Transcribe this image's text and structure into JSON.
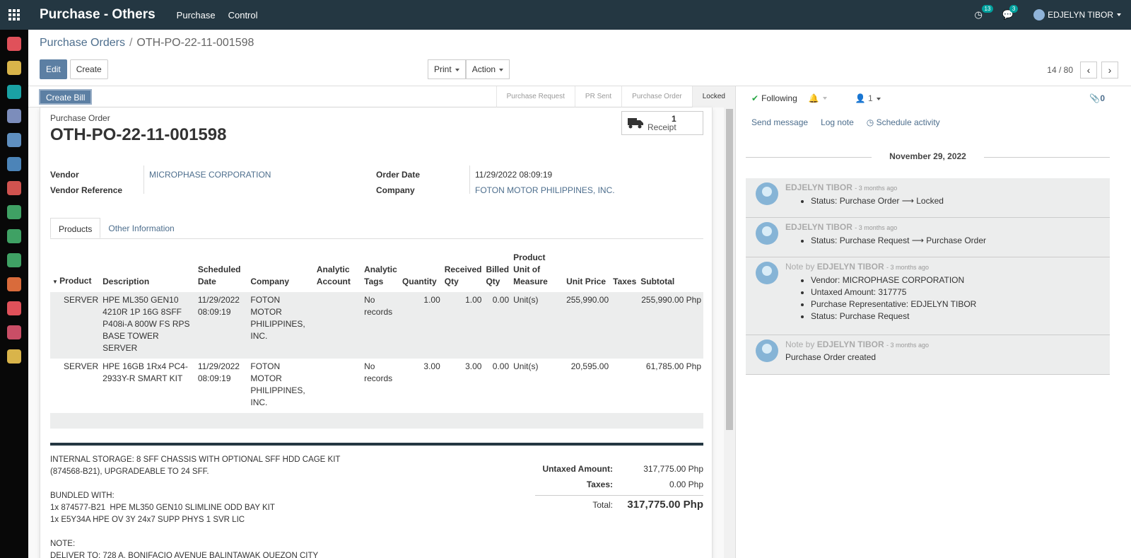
{
  "app": {
    "title": "Purchase - Others",
    "menu": [
      "Purchase",
      "Control"
    ],
    "activity_count": "13",
    "message_count": "3",
    "user": "EDJELYN TIBOR"
  },
  "breadcrumb": {
    "parent": "Purchase Orders",
    "current": "OTH-PO-22-11-001598"
  },
  "controls": {
    "edit": "Edit",
    "create": "Create",
    "print": "Print",
    "action": "Action",
    "pager": "14 / 80"
  },
  "status": {
    "create_bill": "Create Bill",
    "stages": [
      "Purchase Request",
      "PR Sent",
      "Purchase Order",
      "Locked"
    ],
    "active_stage": "Locked"
  },
  "form": {
    "label": "Purchase Order",
    "name": "OTH-PO-22-11-001598",
    "receipt_count": "1",
    "receipt_label": "Receipt",
    "vendor_label": "Vendor",
    "vendor": "MICROPHASE CORPORATION",
    "vendor_ref_label": "Vendor Reference",
    "order_date_label": "Order Date",
    "order_date": "11/29/2022 08:09:19",
    "company_label": "Company",
    "company": "FOTON MOTOR PHILIPPINES, INC.",
    "tabs": [
      "Products",
      "Other Information"
    ]
  },
  "lines": {
    "headers": [
      "Product",
      "Description",
      "Scheduled Date",
      "Company",
      "Analytic Account",
      "Analytic Tags",
      "Quantity",
      "Received Qty",
      "Billed Qty",
      "Product Unit of Measure",
      "Unit Price",
      "Taxes",
      "Subtotal"
    ],
    "rows": [
      {
        "product": "SERVER",
        "description": "HPE ML350 GEN10 4210R 1P 16G 8SFF P408i-A 800W FS RPS BASE TOWER SERVER",
        "date": "11/29/2022 08:09:19",
        "company": "FOTON MOTOR PHILIPPINES, INC.",
        "account": "",
        "tags": "No records",
        "qty": "1.00",
        "received": "1.00",
        "billed": "0.00",
        "uom": "Unit(s)",
        "price": "255,990.00",
        "taxes": "",
        "subtotal": "255,990.00 Php"
      },
      {
        "product": "SERVER",
        "description": "HPE 16GB 1Rx4 PC4-2933Y-R SMART KIT",
        "date": "11/29/2022 08:09:19",
        "company": "FOTON MOTOR PHILIPPINES, INC.",
        "account": "",
        "tags": "No records",
        "qty": "3.00",
        "received": "3.00",
        "billed": "0.00",
        "uom": "Unit(s)",
        "price": "20,595.00",
        "taxes": "",
        "subtotal": "61,785.00 Php"
      }
    ]
  },
  "notes": "INTERNAL STORAGE: 8 SFF CHASSIS WITH OPTIONAL SFF HDD CAGE KIT\n(874568-B21), UPGRADEABLE TO 24 SFF.\n\nBUNDLED WITH:\n1x 874577-B21  HPE ML350 GEN10 SLIMLINE ODD BAY KIT\n1x E5Y34A HPE OV 3Y 24x7 SUPP PHYS 1 SVR LIC\n\nNOTE:\nDELIVER TO: 728 A. BONIFACIO AVENUE BALINTAWAK QUEZON CITY",
  "totals": {
    "untaxed_label": "Untaxed Amount:",
    "untaxed": "317,775.00 Php",
    "taxes_label": "Taxes:",
    "taxes": "0.00 Php",
    "total_label": "Total:",
    "total": "317,775.00 Php"
  },
  "chatter": {
    "following": "Following",
    "followers": "1",
    "attachments": "0",
    "send_message": "Send message",
    "log_note": "Log note",
    "schedule": "Schedule activity",
    "date": "November 29, 2022",
    "messages": [
      {
        "prefix": "",
        "author": "EDJELYN TIBOR",
        "ago": "- 3 months ago",
        "items": [
          "Status: Purchase Order ⟶ Locked"
        ]
      },
      {
        "prefix": "",
        "author": "EDJELYN TIBOR",
        "ago": "- 3 months ago",
        "items": [
          "Status: Purchase Request ⟶ Purchase Order"
        ]
      },
      {
        "prefix": "Note by",
        "author": "EDJELYN TIBOR",
        "ago": "- 3 months ago",
        "items": [
          "Vendor: MICROPHASE CORPORATION",
          "Untaxed Amount: 317775",
          "Purchase Representative: EDJELYN TIBOR",
          "Status: Purchase Request"
        ]
      },
      {
        "prefix": "Note by",
        "author": "EDJELYN TIBOR",
        "ago": "- 3 months ago",
        "body": "Purchase Order created"
      }
    ]
  },
  "sidebar_icons": [
    {
      "name": "discuss-icon",
      "color": "#e0515a"
    },
    {
      "name": "calendar-icon",
      "color": "#d9b44a"
    },
    {
      "name": "contacts-icon",
      "color": "#1aa2a4"
    },
    {
      "name": "crm-icon",
      "color": "#7c8dbb"
    },
    {
      "name": "invoicing-icon",
      "color": "#5f8fbf"
    },
    {
      "name": "accounting-icon",
      "color": "#4c84b8"
    },
    {
      "name": "sales-icon",
      "color": "#d0534f"
    },
    {
      "name": "purchase-icon",
      "color": "#3fa164"
    },
    {
      "name": "purchase-others-icon",
      "color": "#3fa164"
    },
    {
      "name": "purchase-local-icon",
      "color": "#3fa164"
    },
    {
      "name": "invoice-icon",
      "color": "#d96b3b"
    },
    {
      "name": "dashboard-icon",
      "color": "#e0515a"
    },
    {
      "name": "inventory-icon",
      "color": "#c94e66"
    },
    {
      "name": "settings-icon",
      "color": "#d9b44a"
    }
  ]
}
